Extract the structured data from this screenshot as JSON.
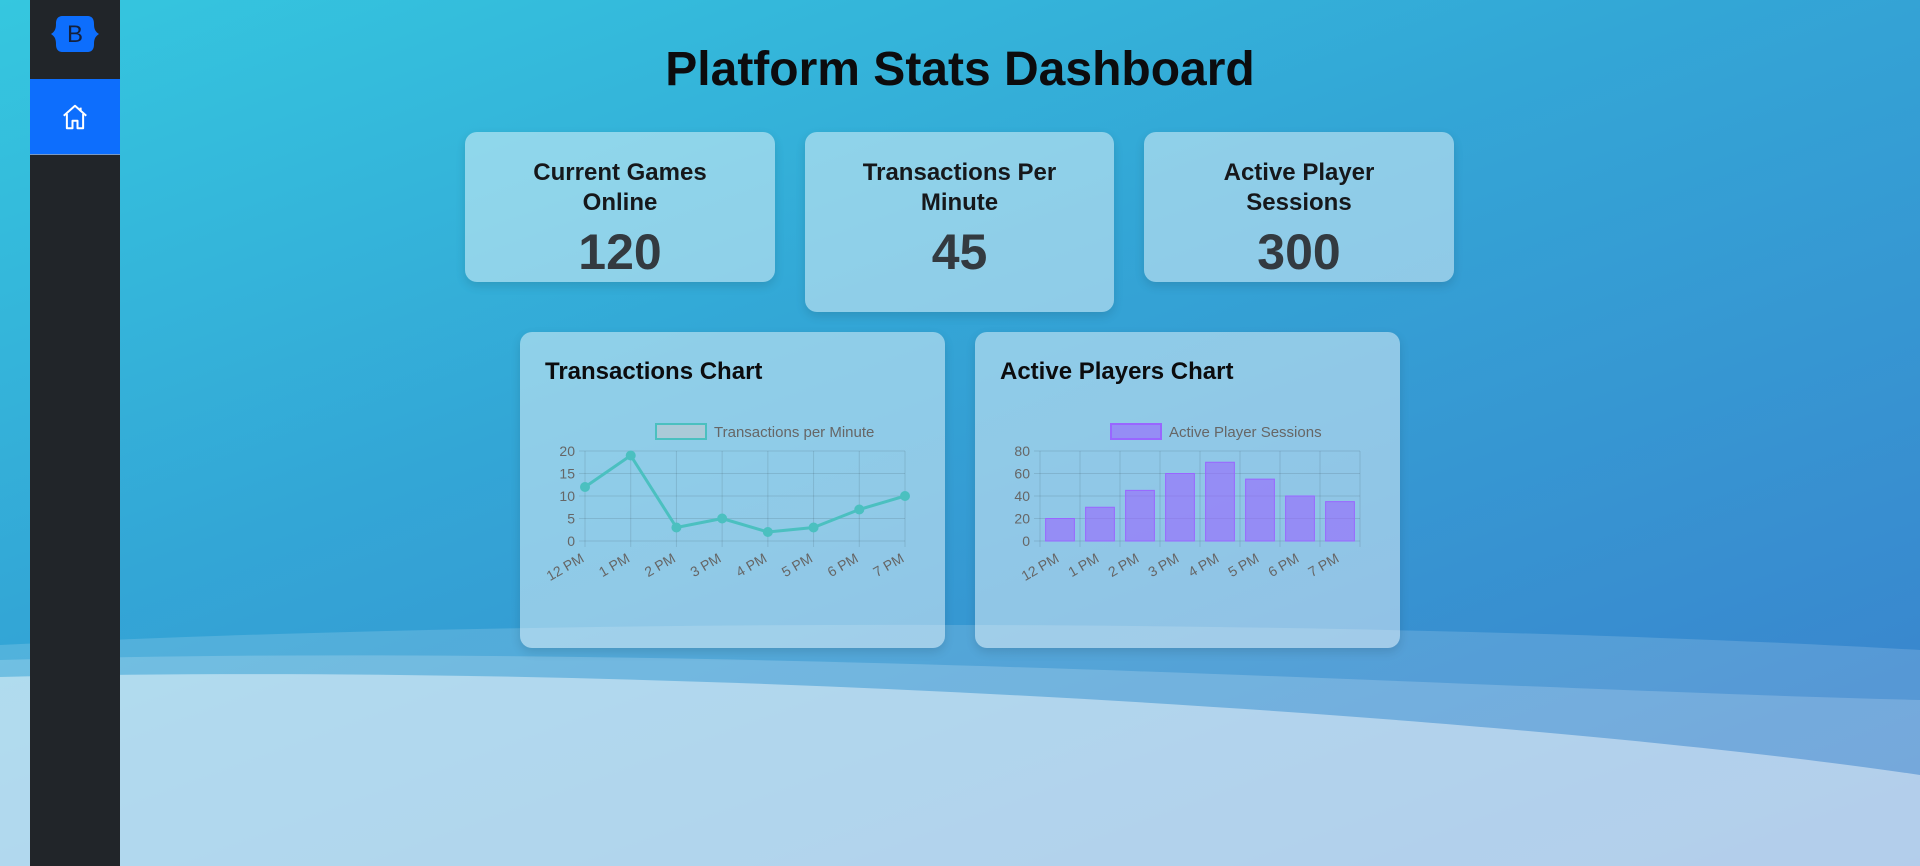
{
  "app": {
    "brand_letter": "B",
    "home_icon": "house-icon"
  },
  "page": {
    "title": "Platform Stats Dashboard"
  },
  "stats": [
    {
      "label": "Current Games Online",
      "value": "120"
    },
    {
      "label": "Transactions Per Minute",
      "value": "45"
    },
    {
      "label": "Active Player Sessions",
      "value": "300"
    }
  ],
  "charts": {
    "transactions_title": "Transactions Chart",
    "players_title": "Active Players Chart"
  },
  "colors": {
    "sidebar": "#212529",
    "nav_active": "#0d6efd",
    "line_series": "#4bc0c0",
    "bar_series": "#9966ff"
  },
  "chart_data": [
    {
      "type": "line",
      "categories": [
        "12 PM",
        "1 PM",
        "2 PM",
        "3 PM",
        "4 PM",
        "5 PM",
        "6 PM",
        "7 PM"
      ],
      "series": [
        {
          "name": "Transactions per Minute",
          "values": [
            12,
            19,
            3,
            5,
            2,
            3,
            7,
            10
          ]
        }
      ],
      "yticks": [
        0,
        5,
        10,
        15,
        20
      ],
      "ylim": [
        0,
        20
      ],
      "grid": true,
      "legend": "top"
    },
    {
      "type": "bar",
      "categories": [
        "12 PM",
        "1 PM",
        "2 PM",
        "3 PM",
        "4 PM",
        "5 PM",
        "6 PM",
        "7 PM"
      ],
      "series": [
        {
          "name": "Active Player Sessions",
          "values": [
            20,
            30,
            45,
            60,
            70,
            55,
            40,
            35
          ]
        }
      ],
      "yticks": [
        0,
        20,
        40,
        60,
        80
      ],
      "ylim": [
        0,
        80
      ],
      "grid": true,
      "legend": "top"
    }
  ]
}
